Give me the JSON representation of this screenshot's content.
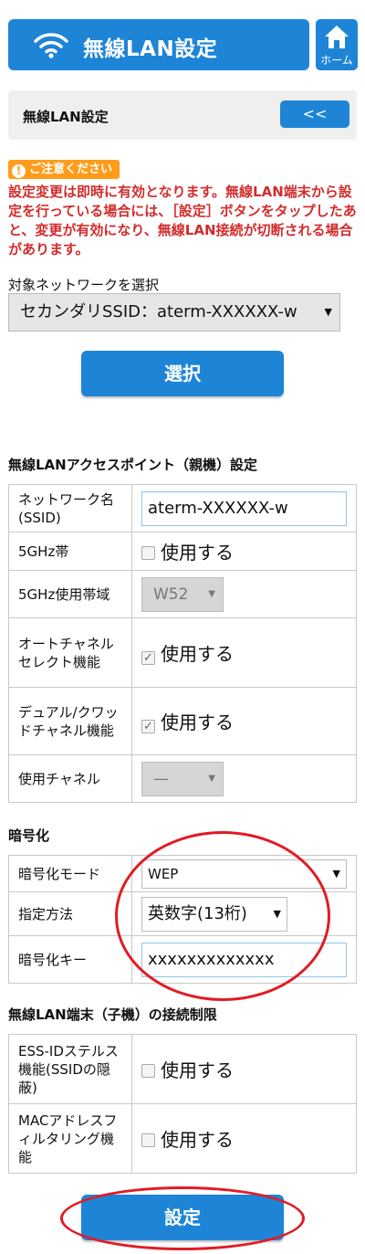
{
  "header": {
    "title": "無線LAN設定",
    "home_label": "ホーム"
  },
  "subheader": {
    "title": "無線LAN設定",
    "back_label": "<<"
  },
  "warning": {
    "badge": "ご注意ください",
    "text": "設定変更は即時に有効となります。無線LAN端末から設定を行っている場合には、［設定］ボタンをタップしたあと、変更が有効になり、無線LAN接続が切断される場合があります。"
  },
  "network": {
    "label": "対象ネットワークを選択",
    "selected": "セカンダリSSID：aterm-XXXXXX-w",
    "select_button": "選択"
  },
  "ap_settings": {
    "title": "無線LANアクセスポイント（親機）設定",
    "ssid_label": "ネットワーク名(SSID)",
    "ssid_value": "aterm-XXXXXX-w",
    "band5_label": "5GHz帯",
    "band5_option": "使用する",
    "band5_range_label": "5GHz使用帯域",
    "band5_range_value": "W52",
    "auto_channel_label": "オートチャネルセレクト機能",
    "auto_channel_option": "使用する",
    "dual_label": "デュアル/クワッドチャネル機能",
    "dual_option": "使用する",
    "channel_label": "使用チャネル",
    "channel_value": "—"
  },
  "encryption": {
    "title": "暗号化",
    "mode_label": "暗号化モード",
    "mode_value": "WEP",
    "method_label": "指定方法",
    "method_value": "英数字(13桁)",
    "key_label": "暗号化キー",
    "key_value": "xxxxxxxxxxxxx"
  },
  "restriction": {
    "title": "無線LAN端末（子機）の接続制限",
    "stealth_label": "ESS-IDステルス機能(SSIDの隠蔽)",
    "stealth_option": "使用する",
    "mac_label": "MACアドレスフィルタリング機能",
    "mac_option": "使用する"
  },
  "footer": {
    "set_button": "設定"
  },
  "colors": {
    "primary": "#1e84d6",
    "warning": "#d22c2c",
    "badge": "#ff9c1a",
    "annotation": "#e21b24"
  }
}
